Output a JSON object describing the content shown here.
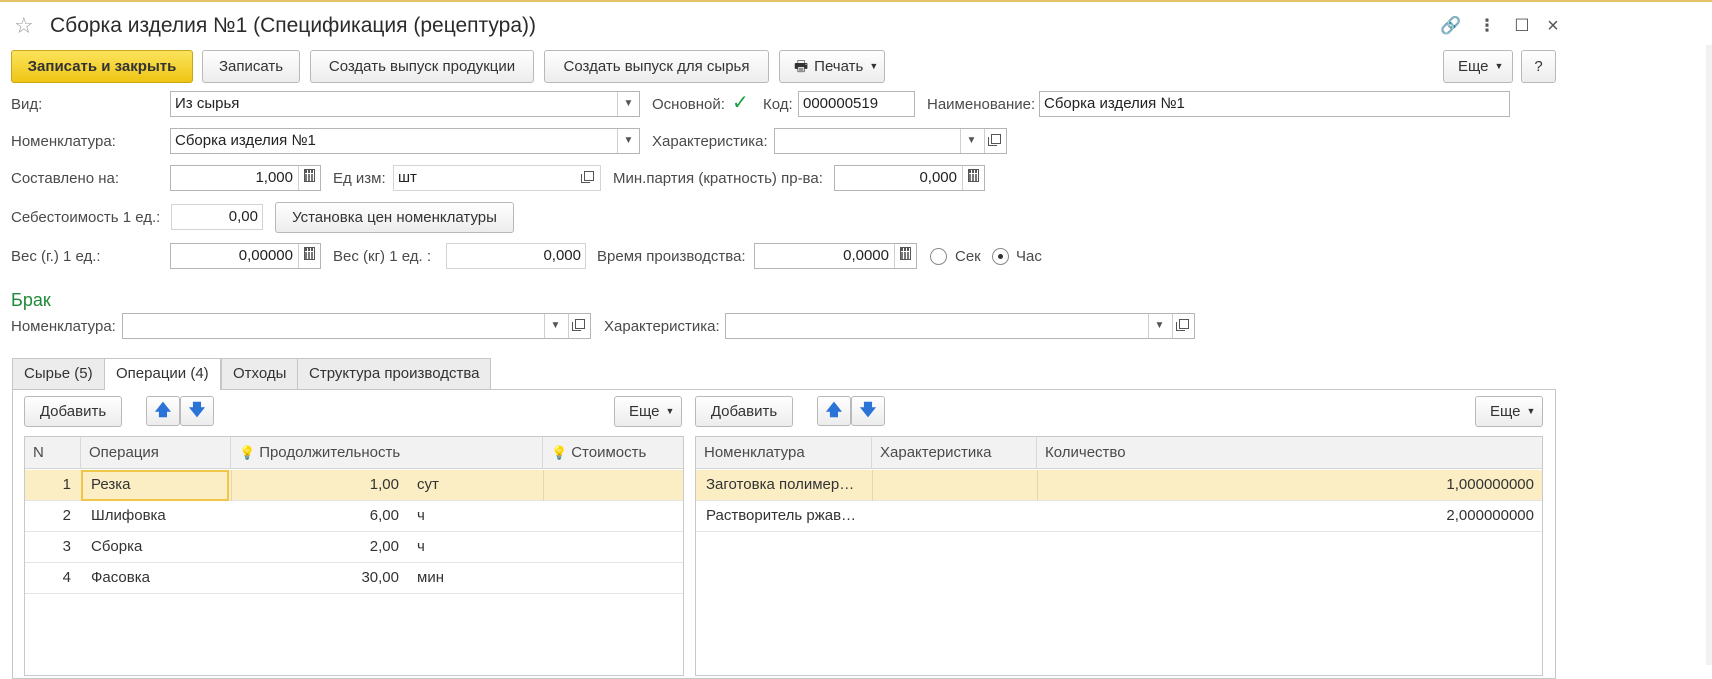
{
  "window": {
    "title": "Сборка изделия №1 (Спецификация (рецептура))"
  },
  "toolbar": {
    "save_close": "Записать и закрыть",
    "save": "Записать",
    "create_product_release": "Создать выпуск продукции",
    "create_raw_release": "Создать выпуск для сырья",
    "print": "Печать",
    "more": "Еще",
    "help": "?"
  },
  "form": {
    "vid_label": "Вид:",
    "vid_value": "Из сырья",
    "main_label": "Основной:",
    "main_checked": true,
    "code_label": "Код:",
    "code_value": "000000519",
    "name_label": "Наименование:",
    "name_value": "Сборка изделия №1",
    "nomen_label": "Номенклатура:",
    "nomen_value": "Сборка изделия №1",
    "char_label": "Характеристика:",
    "char_value": "",
    "composed_label": "Составлено на:",
    "composed_value": "1,000",
    "unit_label": "Ед изм:",
    "unit_value": "шт",
    "minbatch_label": "Мин.партия (кратность) пр-ва:",
    "minbatch_value": "0,000",
    "cost_label": "Себестоимость 1 ед.:",
    "cost_value": "0,00",
    "set_prices_button": "Установка цен номенклатуры",
    "weight_g_label": "Вес (г.)  1 ед.:",
    "weight_g_value": "0,00000",
    "weight_kg_label": "Вес (кг) 1 ед.  :",
    "weight_kg_value": "0,000",
    "prod_time_label": "Время производства:",
    "prod_time_value": "0,0000",
    "radio_sec": "Сек",
    "radio_hour": "Час",
    "radio_selected": "Час"
  },
  "defect": {
    "section_title": "Брак",
    "nomen_label": "Номенклатура:",
    "nomen_value": "",
    "char_label": "Характеристика:",
    "char_value": ""
  },
  "tabs": [
    {
      "label": "Сырье (5)",
      "active": false
    },
    {
      "label": "Операции (4)",
      "active": true
    },
    {
      "label": "Отходы",
      "active": false
    },
    {
      "label": "Структура производства",
      "active": false
    }
  ],
  "left_panel": {
    "add_button": "Добавить",
    "more_button": "Еще",
    "columns": [
      "N",
      "Операция",
      "Продолжительность",
      "Стоимость"
    ],
    "rows": [
      {
        "n": "1",
        "operation": "Резка",
        "duration": "1,00",
        "unit": "сут",
        "cost": ""
      },
      {
        "n": "2",
        "operation": "Шлифовка",
        "duration": "6,00",
        "unit": "ч",
        "cost": ""
      },
      {
        "n": "3",
        "operation": "Сборка",
        "duration": "2,00",
        "unit": "ч",
        "cost": ""
      },
      {
        "n": "4",
        "operation": "Фасовка",
        "duration": "30,00",
        "unit": "мин",
        "cost": ""
      }
    ]
  },
  "right_panel": {
    "add_button": "Добавить",
    "more_button": "Еще",
    "columns": [
      "Номенклатура",
      "Характеристика",
      "Количество"
    ],
    "rows": [
      {
        "nomen": "Заготовка полимер…",
        "char": "",
        "qty": "1,000000000"
      },
      {
        "nomen": "Растворитель ржав…",
        "char": "",
        "qty": "2,000000000"
      }
    ]
  },
  "colors": {
    "primary_button": "#f5d430",
    "section_title": "#1e8a3a",
    "selected_row": "#fbeec4",
    "checkbox": "#1a9c3f"
  }
}
